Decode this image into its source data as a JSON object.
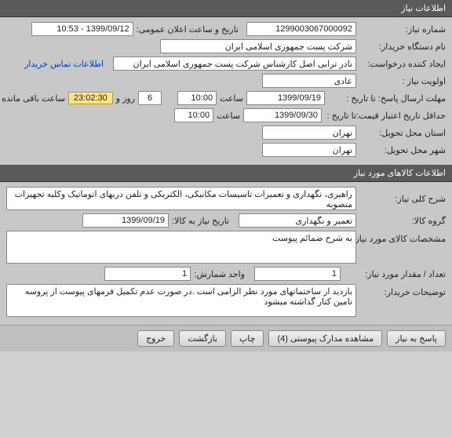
{
  "headers": {
    "need_info": "اطلاعات نیاز",
    "goods_info": "اطلاعات کالاهای مورد نیاز"
  },
  "labels": {
    "need_number": "شماره نیاز:",
    "public_announce_date": "تاریخ و ساعت اعلان عمومی:",
    "org_name": "نام دستگاه خریدار:",
    "creator": "ایجاد کننده درخواست:",
    "priority": "اولویت نیاز :",
    "contact_link": "اطلاعات تماس خریدار",
    "deadline_send": "مهلت ارسال پاسخ:  تا تاریخ :",
    "time_lbl": "ساعت",
    "days_lbl": "روز و",
    "remaining_lbl": "ساعت باقی مانده",
    "min_validity": "حداقل تاریخ اعتبار قیمت:",
    "to_date": "تا تاریخ :",
    "delivery_province": "استان محل تحویل:",
    "delivery_city": "شهر محل تحویل:",
    "main_desc": "شرح کلی نیاز:",
    "goods_group": "گروه کالا:",
    "need_date_goods": "تاریخ نیاز به کالا:",
    "goods_spec": "مشخصات کالای مورد نیاز:",
    "qty": "تعداد / مقدار مورد نیاز:",
    "unit": "واحد شمارش:",
    "buyer_notes": "توضیحات خریدار:"
  },
  "values": {
    "need_number": "1299003067000092",
    "public_announce_date": "1399/09/12 - 10:53",
    "org_name": "شرکت پست جمهوری اسلامی ایران",
    "creator": "نادر ترابی اصل کارشناس شرکت پست جمهوری اسلامی ایران",
    "priority": "عادی",
    "deadline_date": "1399/09/19",
    "deadline_time": "10:00",
    "remaining_days": "6",
    "remaining_time": "23:02:30",
    "validity_date": "1399/09/30",
    "validity_time": "10:00",
    "delivery_province": "تهران",
    "delivery_city": "تهران",
    "main_desc": "راهبری، نگهداری و تعمیرات تاسیسات مکانیکی، الکتریکی و تلفن دربهای اتوماتیک وکلیه تجهیزات منصوبه",
    "goods_group": "تعمیر و نگهداری",
    "need_date_goods": "1399/09/19",
    "goods_spec": "به شرح ضمائم پیوست",
    "qty": "1",
    "unit": "1",
    "buyer_notes": "بازدید از ساختمانهای مورد نظر الزامی است .در صورت عدم تکمیل فرمهای پیوست از پروسه تامین کنار گذاشته میشود"
  },
  "buttons": {
    "reply": "پاسخ به نیاز",
    "attachments": "مشاهده مدارک پیوستی (4)",
    "print": "چاپ",
    "back": "بازگشت",
    "exit": "خروج"
  }
}
